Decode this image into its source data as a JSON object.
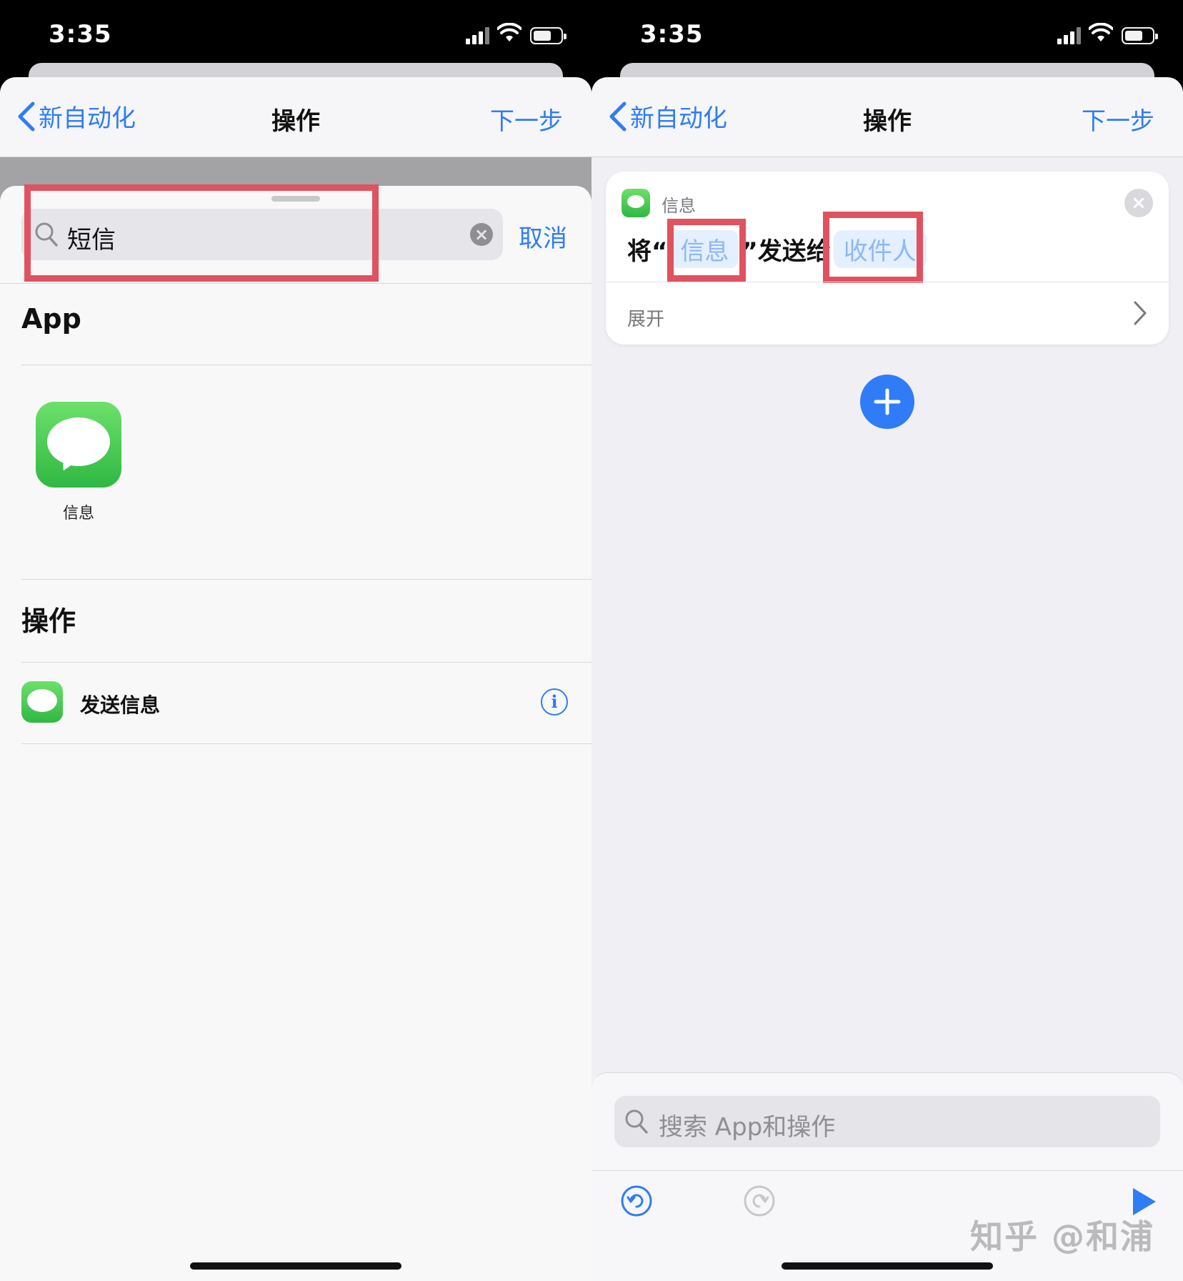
{
  "status_bar": {
    "time": "3:35"
  },
  "left": {
    "nav": {
      "back_label": "新自动化",
      "title": "操作",
      "next_label": "下一步"
    },
    "search": {
      "value": "短信",
      "cancel_label": "取消"
    },
    "sections": {
      "apps_header": "App",
      "apps": [
        {
          "label": "信息",
          "icon": "messages-app-icon"
        }
      ],
      "actions_header": "操作",
      "actions": [
        {
          "label": "发送信息",
          "icon": "messages-app-icon"
        }
      ]
    },
    "accent": "#2f7cf6",
    "highlight_color": "#e05260"
  },
  "right": {
    "nav": {
      "back_label": "新自动化",
      "title": "操作",
      "next_label": "下一步"
    },
    "action_card": {
      "app_name": "信息",
      "sentence_prefix": "将“",
      "message_token": "信息",
      "sentence_mid": "”发送给",
      "recipient_token": "收件人",
      "expand_label": "展开"
    },
    "bottom": {
      "search_placeholder": "搜索 App和操作"
    },
    "watermark": "知乎 @和浦"
  }
}
